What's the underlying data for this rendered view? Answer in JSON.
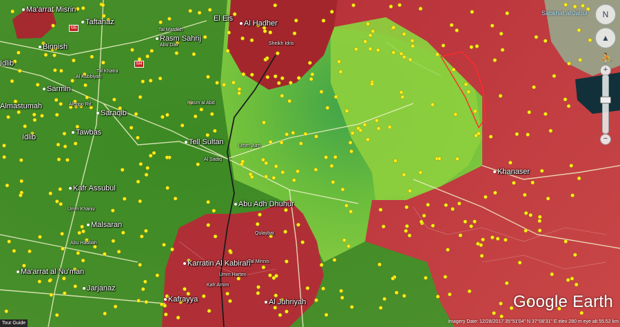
{
  "map": {
    "colors": {
      "green_zone": "#7ed14e",
      "green_zone_dark": "#2e7d1a",
      "red_zone": "#c73c3c",
      "red_zone_dark": "#8f1f26",
      "dot": "#ffee1a",
      "road": "#f0f0c8",
      "front_line": "#1c1c1c"
    },
    "labels": {
      "maarrat_misrin": "Ma'arrat Misrin",
      "taftanaz": "Taftanaz",
      "binnish": "Binnish",
      "sarmin": "Sarmin",
      "idlib_town": "Idlib",
      "idlib_city": "Idlib",
      "almastumah": "Almastumah",
      "saraqib": "Saraqib",
      "tal_sultan": "Tell Sultan",
      "kafr_sajna": "Kafr Assubul",
      "abu_adh_dhuhur": "Abu Adh Dhuhur",
      "malsaran": "Malsaran",
      "maarrat_numan": "Ma'arrat al Nu'man",
      "jarjanaz": "Jarjanaz",
      "karratin": "Karratin Al Kabirah",
      "kafrayya": "Kafrayya",
      "al_hadher": "Al Hadher",
      "eis": "El Eis",
      "khanaser": "Khanaser",
      "al_juhriyah": "Al Juhriyah",
      "rasm_sahrij": "Rasm Sahrij",
      "sabkhat_al_jabul": "Sabkhat al Jabul",
      "saraqib_south": "Saraqib",
      "tawbas": "Tawbas"
    },
    "small_labels": [
      "Tal Mardikh",
      "Abu Dali",
      "Aleppo Rd",
      "Al Kubbiyah",
      "Tal Khatra",
      "Rasm al Abd",
      "Umm Jurn",
      "Al Sadiq",
      "Abu Habbah",
      "Umm Khaniz",
      "Tal Minnis",
      "Umm Harten",
      "Qulaybat",
      "Sheikh Idris",
      "Kafr Amim"
    ],
    "road_badges": [
      "M5",
      "M4"
    ],
    "logo": "Google Earth",
    "status_bar": "Imagery Date: 12/28/2017   35°51'04\" N 37°08'31\" E   elev  280 m   eye alt 55.52 km",
    "tour_guide": "Tour Guide",
    "lake_label": "Sabkhat al Jabul"
  },
  "controls": {
    "compass_glyph": "N",
    "tilt_glyph": "▲",
    "zoom_in": "+",
    "zoom_out": "−",
    "pegman_glyph": "⛹"
  }
}
